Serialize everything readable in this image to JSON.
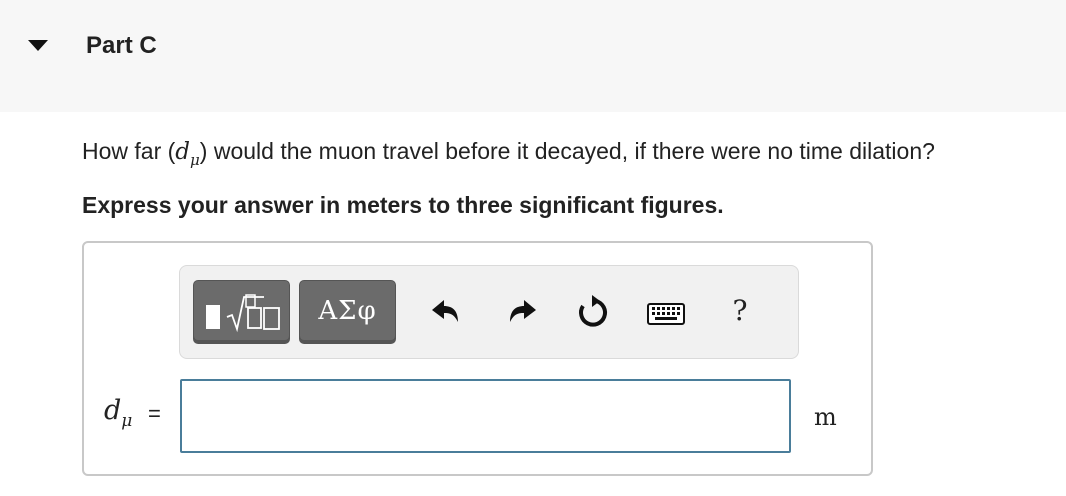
{
  "part": {
    "title": "Part C"
  },
  "question": {
    "before": "How far (",
    "variable": "d",
    "subscript": "μ",
    "after": ") would the muon travel before it decayed, if there were no time dilation?"
  },
  "instruction": "Express your answer in meters to three significant figures.",
  "toolbar": {
    "templates_icon": "templates-sqrt-icon",
    "greek_label": "ΑΣφ",
    "undo_icon": "undo-icon",
    "redo_icon": "redo-icon",
    "reset_icon": "reset-icon",
    "keyboard_icon": "keyboard-icon",
    "help_label": "?"
  },
  "answer": {
    "variable": "d",
    "subscript": "μ",
    "equals": "=",
    "value": "",
    "unit": "m"
  },
  "colors": {
    "header_bg": "#f7f7f7",
    "toolbar_button": "#6b6b6b",
    "input_border": "#4a7d9a"
  }
}
